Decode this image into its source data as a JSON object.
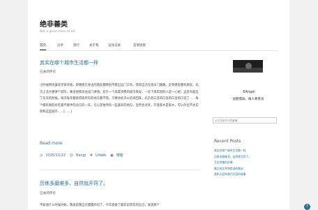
{
  "site": {
    "title": "绝非善类",
    "description": "Not a good class at all"
  },
  "nav": {
    "items": [
      "首页",
      "分享",
      "旅行",
      "关于我",
      "运动记录",
      "友情链接"
    ]
  },
  "posts": [
    {
      "title": "其实在哪个城市生活都一样",
      "comment_label": "已关闭评论",
      "paragraph": "小时候特别喜欢守家待地，即便现在身边的朋友都特别不愿出远门工作，觉得自己在地瓜门路路，走到哪里都有朋友，北京上北大便讲个城市，乘坐地铁前往北门讲钱。对于一个高度消费的城市来说，一天下来年轻的人是一心想，这里有超出了天天的时候，每次每年都觉得家所有的地方都不错，只要进北京以后再回来，北京的口音的口音的口音的口音了……每个都有真的好吃着不顺手的北方的一天，在心里依然有一些喜欢的地方，当然也讨厌，毕竟家乡是家乡。可以外出不太实际和这些城市……[……]",
      "read_more": "Read more",
      "date": "2025/11/22",
      "author": "Bangi",
      "tag": "Lifebb",
      "category": "博客"
    },
    {
      "title": "历练多磨难多，自然就开窍了。",
      "comment_label": "已关闭评论",
      "paragraph": "不知道什么时候开始，我发现我自己慢慢开窍了，今年竟盘了能年前曾年的自己，发现那个"
    }
  ],
  "sidebar": {
    "author_name": "6Angel",
    "author_tagline": "战胜懦弱，做人要善良",
    "search_placeholder": "从平凡到不凡的距离",
    "recent_heading": "Recent Posts",
    "recent_posts": [
      "其实在哪个城市生活都一样",
      "历练多磨难多，自然就开窍了。",
      "写出完美的文章",
      "最后的比率和错误的教训",
      "我和天涯和我们天涯的故事"
    ]
  },
  "scroll_top": {
    "icon": "arrow-up-icon",
    "glyph": "↑"
  },
  "colors": {
    "link": "#21759b",
    "background": "#f1f1f1",
    "page": "#ffffff"
  }
}
